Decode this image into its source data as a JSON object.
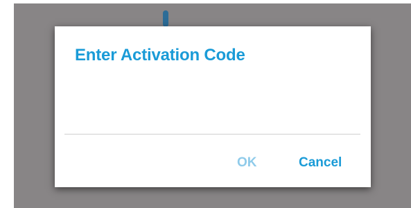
{
  "dialog": {
    "title": "Enter Activation Code",
    "input": {
      "value": "",
      "placeholder": ""
    },
    "buttons": {
      "ok_label": "OK",
      "cancel_label": "Cancel"
    }
  },
  "colors": {
    "accent": "#1a9bd7",
    "disabled_accent": "#8fcbea",
    "scrim": "#888586"
  }
}
